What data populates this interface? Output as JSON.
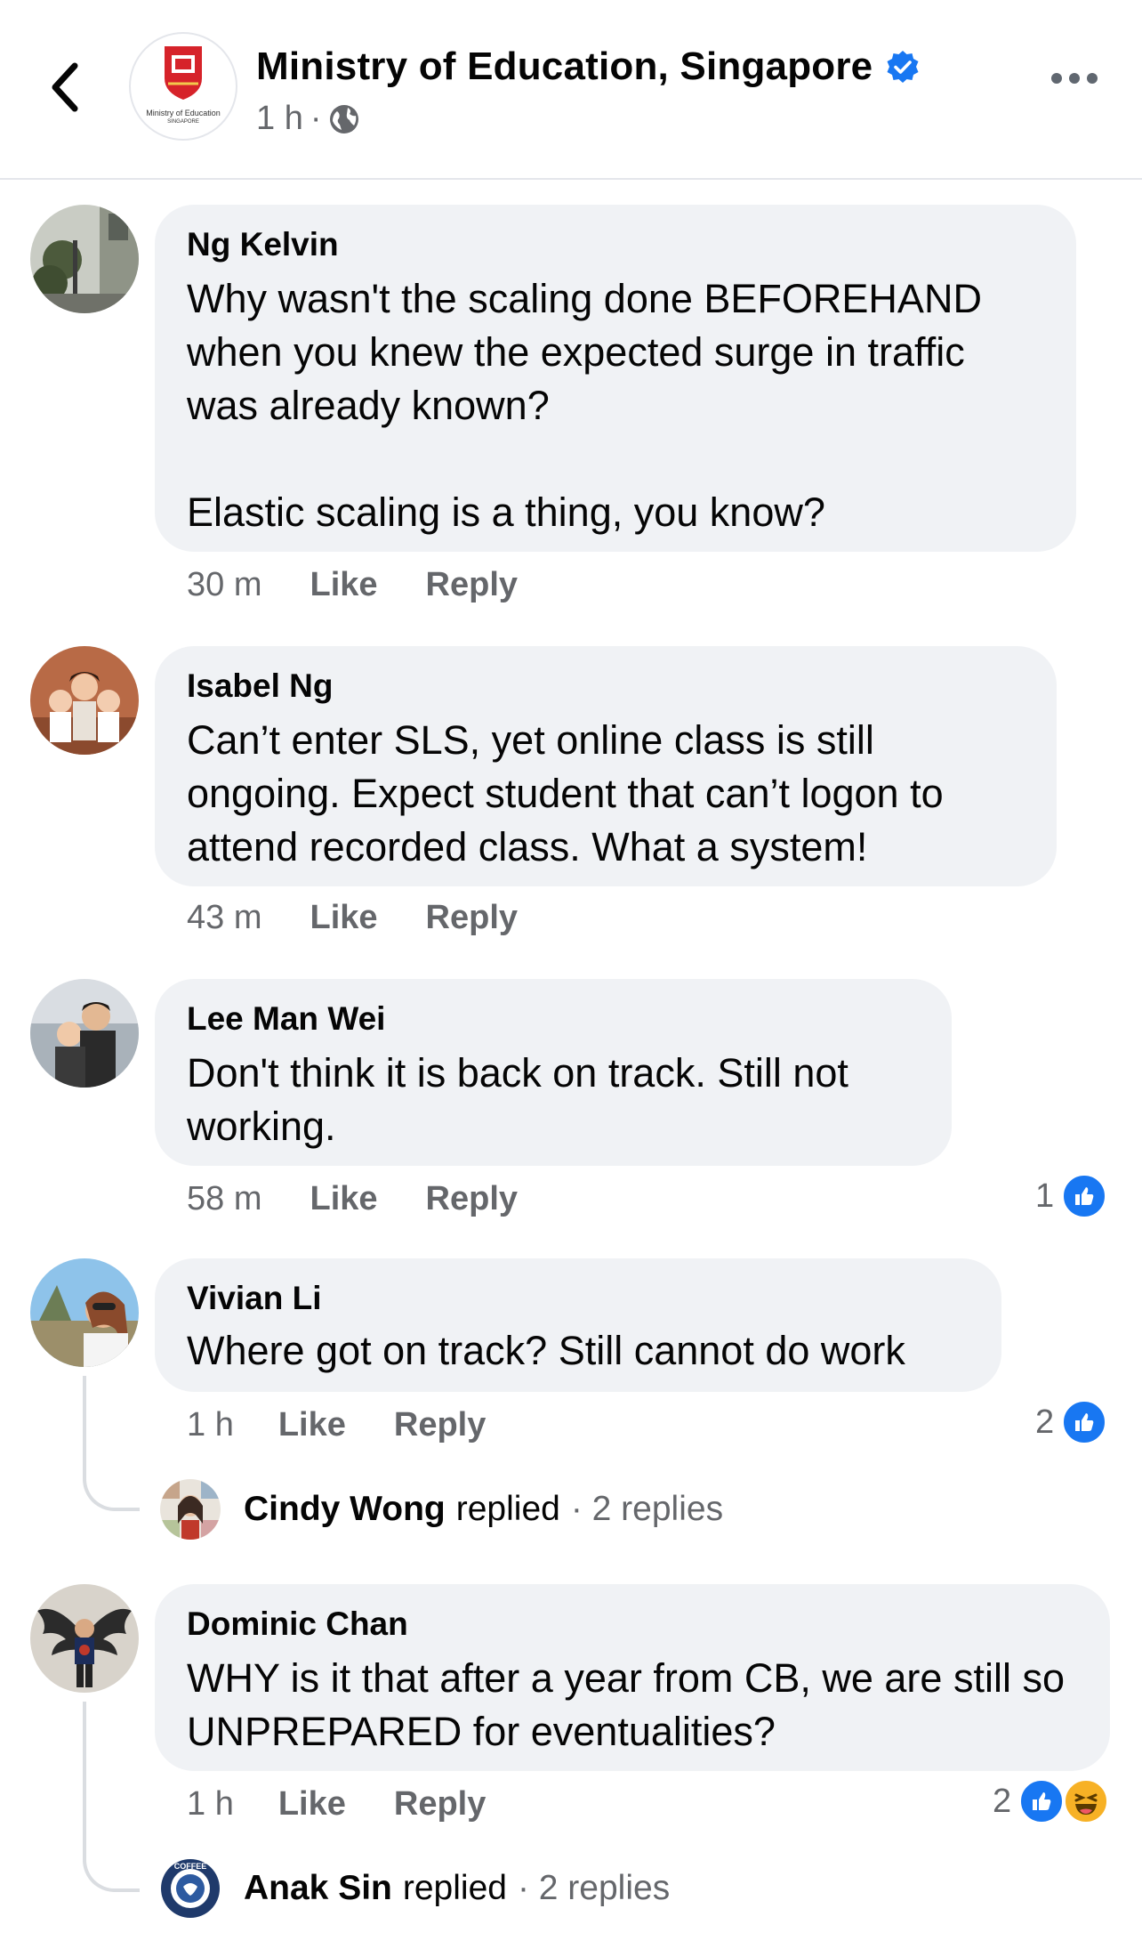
{
  "header": {
    "page_name": "Ministry of Education, Singapore",
    "logo_text": "Ministry of Education",
    "logo_subtext": "SINGAPORE",
    "time": "1 h",
    "dot": "·",
    "verified_icon": "verified-badge-icon",
    "audience_icon": "globe-icon"
  },
  "comments": [
    {
      "author": "Ng Kelvin",
      "text": "Why wasn't the scaling done BEFOREHAND when you knew the expected surge in traffic was already known?\n\nElastic scaling is a thing, you know?",
      "time": "30 m",
      "like": "Like",
      "reply": "Reply"
    },
    {
      "author": "Isabel Ng",
      "text": "Can’t enter SLS, yet online class is still ongoing. Expect student that can’t logon to attend recorded class. What a system!",
      "time": "43 m",
      "like": "Like",
      "reply": "Reply"
    },
    {
      "author": "Lee Man Wei",
      "text": "Don't think it is back on track. Still not working.",
      "time": "58 m",
      "like": "Like",
      "reply": "Reply",
      "reaction_count": "1"
    },
    {
      "author": "Vivian Li",
      "text": "Where got on track? Still cannot do work",
      "time": "1 h",
      "like": "Like",
      "reply": "Reply",
      "reaction_count": "2",
      "replies": {
        "name": "Cindy Wong",
        "verb": "replied",
        "count": "· 2 replies"
      }
    },
    {
      "author": "Dominic Chan",
      "text": "WHY is it that after a year from CB, we are still so UNPREPARED for eventualities?",
      "time": "1 h",
      "like": "Like",
      "reply": "Reply",
      "reaction_count": "2",
      "replies": {
        "name": "Anak Sin",
        "verb": "replied",
        "count": "· 2 replies",
        "avatar_text": "COFFEE"
      }
    }
  ],
  "colors": {
    "accent": "#1877f2",
    "bubble": "#f0f2f5",
    "muted": "#65676b",
    "haha": "#f7b125"
  }
}
